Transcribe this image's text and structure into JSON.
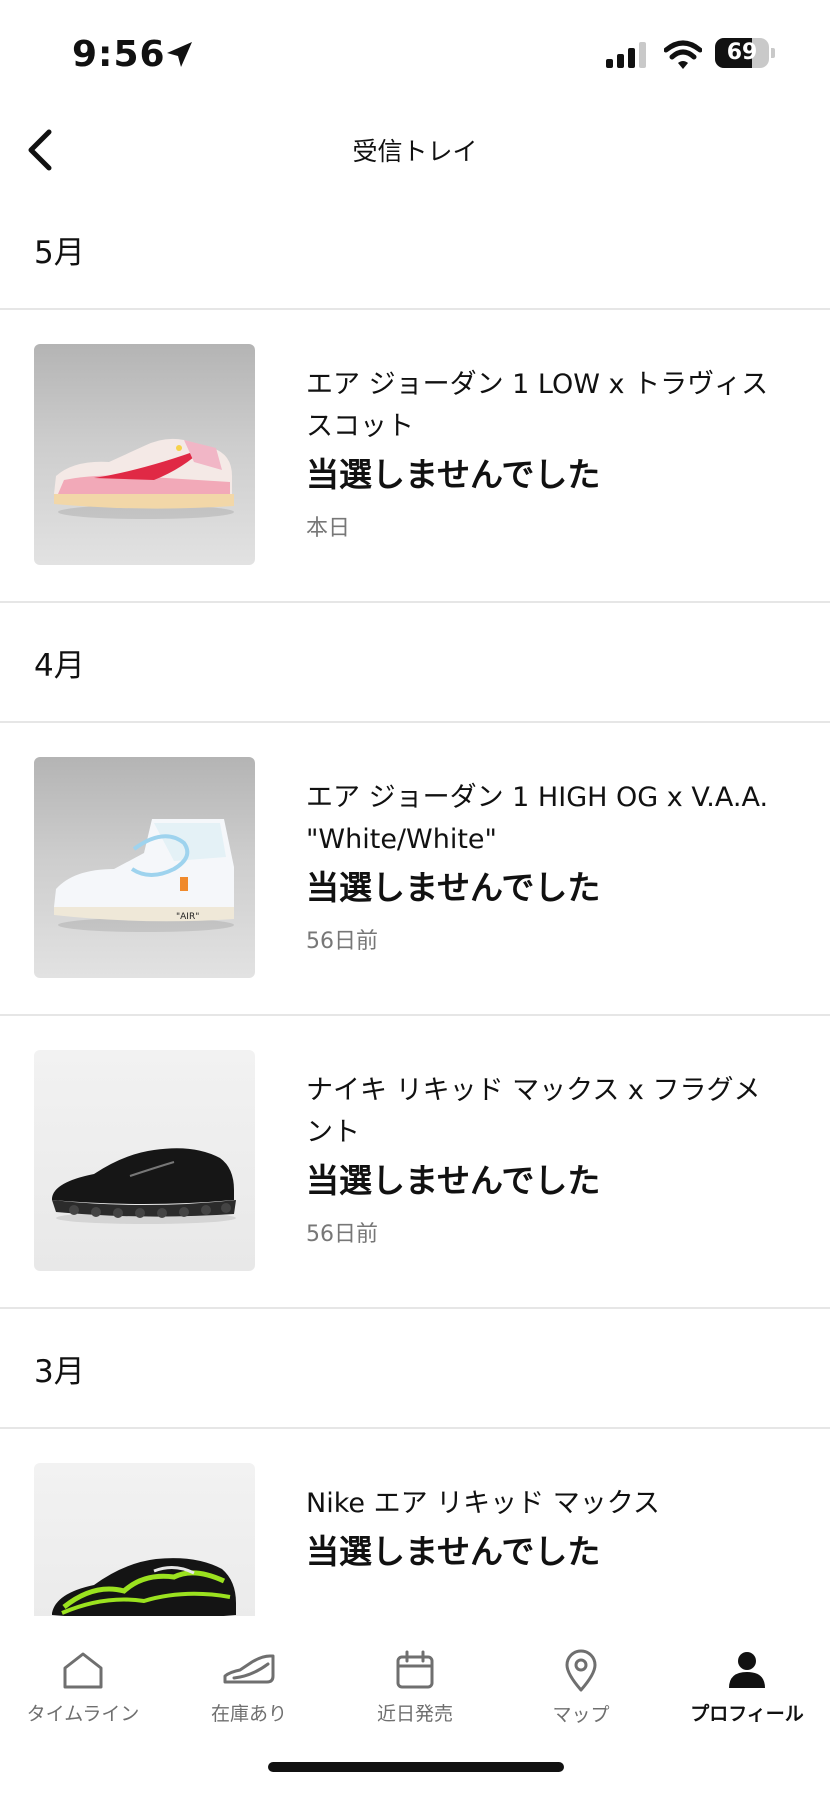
{
  "status_bar": {
    "time": "9:56",
    "battery_level": "69",
    "battery_fraction": 0.69
  },
  "header": {
    "title": "受信トレイ",
    "back_icon": "chevron-left-icon"
  },
  "sections": [
    {
      "month": "5月",
      "items": [
        {
          "name": "エア ジョーダン 1 LOW x トラヴィス スコット",
          "status": "当選しませんでした",
          "date": "本日",
          "image": "pink-low-sneaker"
        }
      ]
    },
    {
      "month": "4月",
      "items": [
        {
          "name": "エア ジョーダン 1 HIGH OG x V.A.A. \"White/White\"",
          "status": "当選しませんでした",
          "date": "56日前",
          "image": "white-high-sneaker"
        },
        {
          "name": "ナイキ リキッド マックス x フラグメント",
          "status": "当選しませんでした",
          "date": "56日前",
          "image": "black-runner-sneaker"
        }
      ]
    },
    {
      "month": "3月",
      "items": [
        {
          "name": "Nike エア リキッド マックス",
          "status": "当選しませんでした",
          "date": "",
          "image": "green-black-sneaker"
        }
      ]
    }
  ],
  "tab_bar": {
    "tabs": [
      {
        "label": "タイムライン",
        "icon": "home-icon",
        "active": false
      },
      {
        "label": "在庫あり",
        "icon": "shoe-icon",
        "active": false
      },
      {
        "label": "近日発売",
        "icon": "calendar-icon",
        "active": false
      },
      {
        "label": "マップ",
        "icon": "map-pin-icon",
        "active": false
      },
      {
        "label": "プロフィール",
        "icon": "profile-icon",
        "active": true
      }
    ]
  },
  "colors": {
    "text": "#111111",
    "secondary_text": "#777777",
    "divider": "#e6e6e6",
    "inactive_tab": "#6f6f6f"
  }
}
